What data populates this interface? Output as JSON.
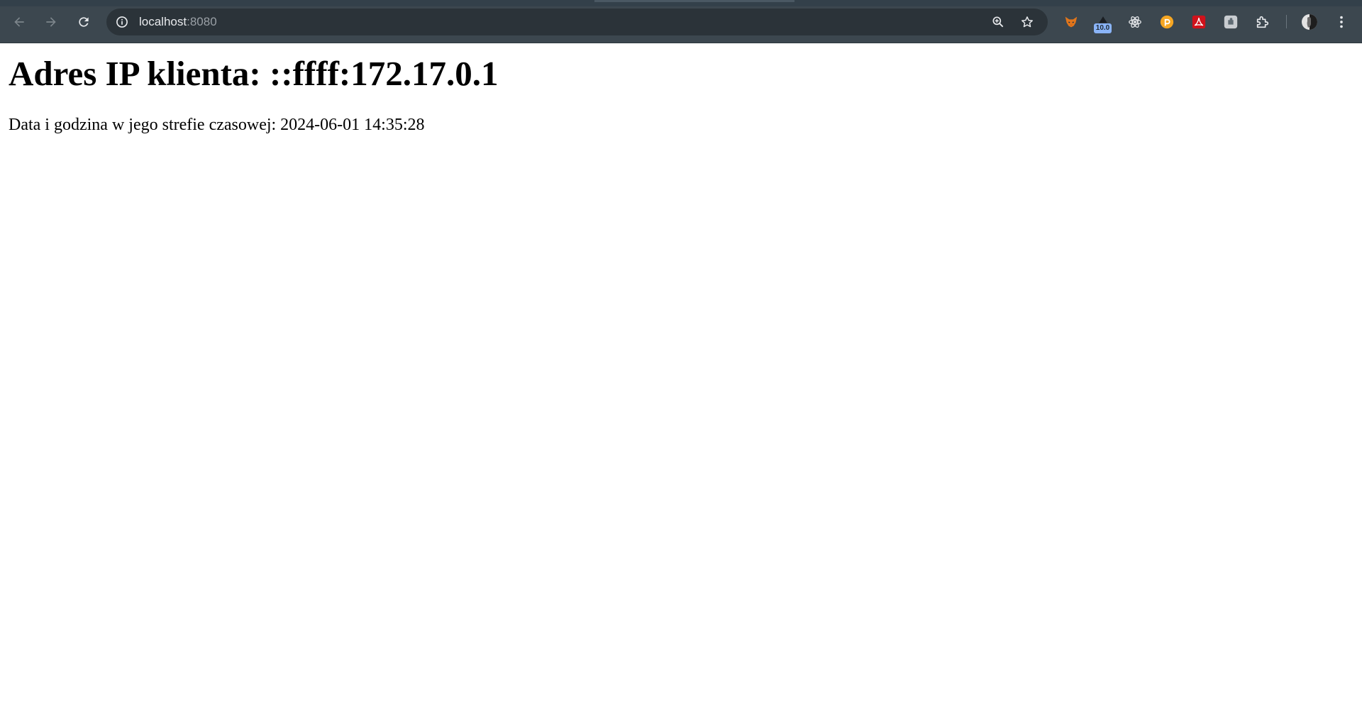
{
  "browser": {
    "url_host": "localhost",
    "url_port": ":8080",
    "extension_badge": "10.0",
    "icons": {
      "back": "arrow-left-icon",
      "forward": "arrow-right-icon",
      "reload": "reload-icon",
      "site_info": "info-circle-icon",
      "zoom": "zoom-in-icon",
      "bookmark": "star-icon",
      "extensions": [
        "fox-icon",
        "badge-extension-icon",
        "react-atom-icon",
        "orange-circle-extension-icon",
        "pdf-icon",
        "puzzle-tile-extension-icon",
        "puzzle-piece-icon"
      ],
      "profile": "avatar-icon",
      "menu": "kebab-menu-icon"
    },
    "colors": {
      "toolbar": "#3c474f",
      "omnibox": "#2b3339",
      "icon": "#e8eaed"
    }
  },
  "page": {
    "heading": "Adres IP klienta: ::ffff:172.17.0.1",
    "datetime_line": "Data i godzina w jego strefie czasowej: 2024-06-01 14:35:28"
  }
}
